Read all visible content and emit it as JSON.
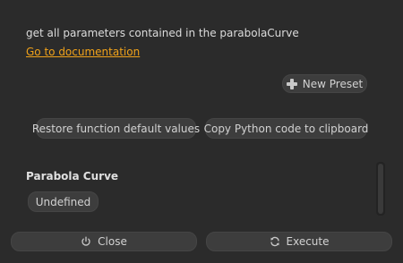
{
  "function": {
    "description": "get all parameters contained in the parabolaCurve",
    "documentation_link": "Go to documentation"
  },
  "presets": {
    "new_preset_label": "New Preset",
    "icon": "plus-icon"
  },
  "actions": {
    "restore_label": "Restore function default values",
    "copy_python_label": "Copy Python code to clipboard"
  },
  "parameters": {
    "section_title": "Parabola Curve",
    "value_label": "Undefined"
  },
  "footer": {
    "close_label": "Close",
    "close_icon": "power-icon",
    "execute_label": "Execute",
    "execute_icon": "refresh-icon"
  },
  "colors": {
    "background": "#2b2b2b",
    "button": "#3d3d3d",
    "link": "#f0a21a",
    "text": "#d6d6d6"
  }
}
